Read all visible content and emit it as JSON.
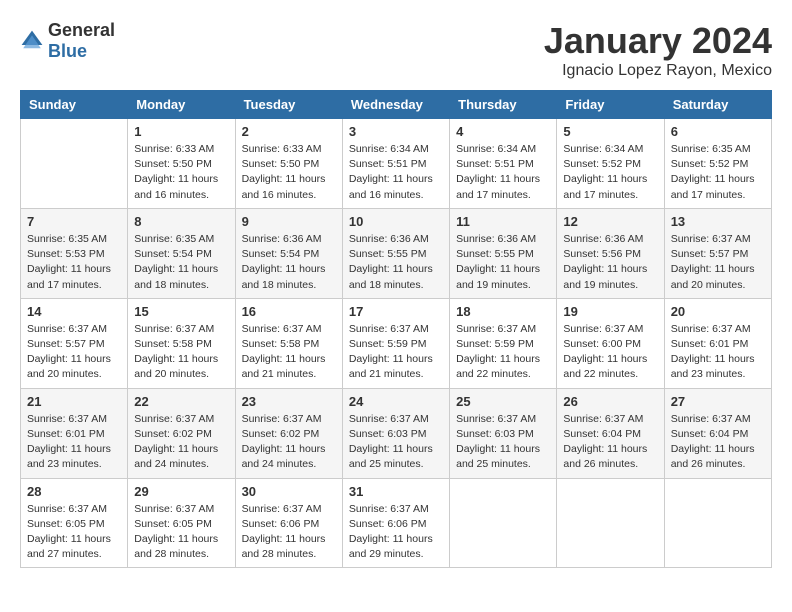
{
  "header": {
    "logo_general": "General",
    "logo_blue": "Blue",
    "month": "January 2024",
    "location": "Ignacio Lopez Rayon, Mexico"
  },
  "days_of_week": [
    "Sunday",
    "Monday",
    "Tuesday",
    "Wednesday",
    "Thursday",
    "Friday",
    "Saturday"
  ],
  "weeks": [
    [
      {
        "day": "",
        "sunrise": "",
        "sunset": "",
        "daylight": ""
      },
      {
        "day": "1",
        "sunrise": "Sunrise: 6:33 AM",
        "sunset": "Sunset: 5:50 PM",
        "daylight": "Daylight: 11 hours and 16 minutes."
      },
      {
        "day": "2",
        "sunrise": "Sunrise: 6:33 AM",
        "sunset": "Sunset: 5:50 PM",
        "daylight": "Daylight: 11 hours and 16 minutes."
      },
      {
        "day": "3",
        "sunrise": "Sunrise: 6:34 AM",
        "sunset": "Sunset: 5:51 PM",
        "daylight": "Daylight: 11 hours and 16 minutes."
      },
      {
        "day": "4",
        "sunrise": "Sunrise: 6:34 AM",
        "sunset": "Sunset: 5:51 PM",
        "daylight": "Daylight: 11 hours and 17 minutes."
      },
      {
        "day": "5",
        "sunrise": "Sunrise: 6:34 AM",
        "sunset": "Sunset: 5:52 PM",
        "daylight": "Daylight: 11 hours and 17 minutes."
      },
      {
        "day": "6",
        "sunrise": "Sunrise: 6:35 AM",
        "sunset": "Sunset: 5:52 PM",
        "daylight": "Daylight: 11 hours and 17 minutes."
      }
    ],
    [
      {
        "day": "7",
        "sunrise": "Sunrise: 6:35 AM",
        "sunset": "Sunset: 5:53 PM",
        "daylight": "Daylight: 11 hours and 17 minutes."
      },
      {
        "day": "8",
        "sunrise": "Sunrise: 6:35 AM",
        "sunset": "Sunset: 5:54 PM",
        "daylight": "Daylight: 11 hours and 18 minutes."
      },
      {
        "day": "9",
        "sunrise": "Sunrise: 6:36 AM",
        "sunset": "Sunset: 5:54 PM",
        "daylight": "Daylight: 11 hours and 18 minutes."
      },
      {
        "day": "10",
        "sunrise": "Sunrise: 6:36 AM",
        "sunset": "Sunset: 5:55 PM",
        "daylight": "Daylight: 11 hours and 18 minutes."
      },
      {
        "day": "11",
        "sunrise": "Sunrise: 6:36 AM",
        "sunset": "Sunset: 5:55 PM",
        "daylight": "Daylight: 11 hours and 19 minutes."
      },
      {
        "day": "12",
        "sunrise": "Sunrise: 6:36 AM",
        "sunset": "Sunset: 5:56 PM",
        "daylight": "Daylight: 11 hours and 19 minutes."
      },
      {
        "day": "13",
        "sunrise": "Sunrise: 6:37 AM",
        "sunset": "Sunset: 5:57 PM",
        "daylight": "Daylight: 11 hours and 20 minutes."
      }
    ],
    [
      {
        "day": "14",
        "sunrise": "Sunrise: 6:37 AM",
        "sunset": "Sunset: 5:57 PM",
        "daylight": "Daylight: 11 hours and 20 minutes."
      },
      {
        "day": "15",
        "sunrise": "Sunrise: 6:37 AM",
        "sunset": "Sunset: 5:58 PM",
        "daylight": "Daylight: 11 hours and 20 minutes."
      },
      {
        "day": "16",
        "sunrise": "Sunrise: 6:37 AM",
        "sunset": "Sunset: 5:58 PM",
        "daylight": "Daylight: 11 hours and 21 minutes."
      },
      {
        "day": "17",
        "sunrise": "Sunrise: 6:37 AM",
        "sunset": "Sunset: 5:59 PM",
        "daylight": "Daylight: 11 hours and 21 minutes."
      },
      {
        "day": "18",
        "sunrise": "Sunrise: 6:37 AM",
        "sunset": "Sunset: 5:59 PM",
        "daylight": "Daylight: 11 hours and 22 minutes."
      },
      {
        "day": "19",
        "sunrise": "Sunrise: 6:37 AM",
        "sunset": "Sunset: 6:00 PM",
        "daylight": "Daylight: 11 hours and 22 minutes."
      },
      {
        "day": "20",
        "sunrise": "Sunrise: 6:37 AM",
        "sunset": "Sunset: 6:01 PM",
        "daylight": "Daylight: 11 hours and 23 minutes."
      }
    ],
    [
      {
        "day": "21",
        "sunrise": "Sunrise: 6:37 AM",
        "sunset": "Sunset: 6:01 PM",
        "daylight": "Daylight: 11 hours and 23 minutes."
      },
      {
        "day": "22",
        "sunrise": "Sunrise: 6:37 AM",
        "sunset": "Sunset: 6:02 PM",
        "daylight": "Daylight: 11 hours and 24 minutes."
      },
      {
        "day": "23",
        "sunrise": "Sunrise: 6:37 AM",
        "sunset": "Sunset: 6:02 PM",
        "daylight": "Daylight: 11 hours and 24 minutes."
      },
      {
        "day": "24",
        "sunrise": "Sunrise: 6:37 AM",
        "sunset": "Sunset: 6:03 PM",
        "daylight": "Daylight: 11 hours and 25 minutes."
      },
      {
        "day": "25",
        "sunrise": "Sunrise: 6:37 AM",
        "sunset": "Sunset: 6:03 PM",
        "daylight": "Daylight: 11 hours and 25 minutes."
      },
      {
        "day": "26",
        "sunrise": "Sunrise: 6:37 AM",
        "sunset": "Sunset: 6:04 PM",
        "daylight": "Daylight: 11 hours and 26 minutes."
      },
      {
        "day": "27",
        "sunrise": "Sunrise: 6:37 AM",
        "sunset": "Sunset: 6:04 PM",
        "daylight": "Daylight: 11 hours and 26 minutes."
      }
    ],
    [
      {
        "day": "28",
        "sunrise": "Sunrise: 6:37 AM",
        "sunset": "Sunset: 6:05 PM",
        "daylight": "Daylight: 11 hours and 27 minutes."
      },
      {
        "day": "29",
        "sunrise": "Sunrise: 6:37 AM",
        "sunset": "Sunset: 6:05 PM",
        "daylight": "Daylight: 11 hours and 28 minutes."
      },
      {
        "day": "30",
        "sunrise": "Sunrise: 6:37 AM",
        "sunset": "Sunset: 6:06 PM",
        "daylight": "Daylight: 11 hours and 28 minutes."
      },
      {
        "day": "31",
        "sunrise": "Sunrise: 6:37 AM",
        "sunset": "Sunset: 6:06 PM",
        "daylight": "Daylight: 11 hours and 29 minutes."
      },
      {
        "day": "",
        "sunrise": "",
        "sunset": "",
        "daylight": ""
      },
      {
        "day": "",
        "sunrise": "",
        "sunset": "",
        "daylight": ""
      },
      {
        "day": "",
        "sunrise": "",
        "sunset": "",
        "daylight": ""
      }
    ]
  ]
}
